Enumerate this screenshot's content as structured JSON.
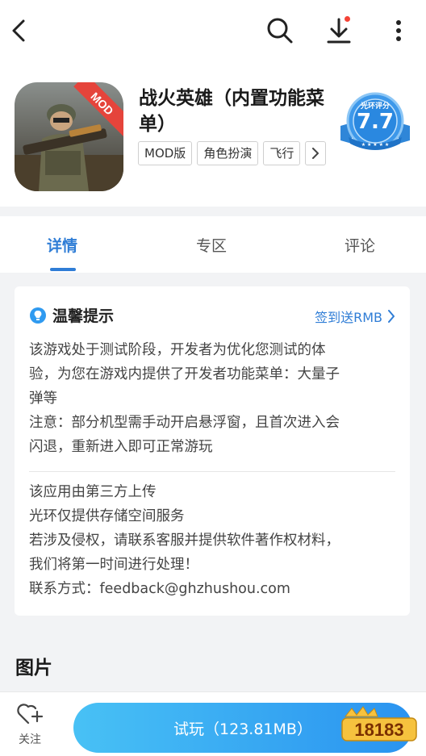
{
  "header": {
    "title": "战火英雄（内置功能菜单）",
    "icon_badge": "MOD",
    "tags": [
      "MOD版",
      "角色扮演",
      "飞行"
    ],
    "rating_label": "光环评分",
    "rating_score": "7.7"
  },
  "tabs": [
    {
      "label": "详情",
      "active": true
    },
    {
      "label": "专区",
      "active": false
    },
    {
      "label": "评论",
      "active": false
    }
  ],
  "notice": {
    "title": "温馨提示",
    "link": "签到送RMB",
    "lines1": [
      "该游戏处于测试阶段，开发者为优化您测试的体",
      "验，为您在游戏内提供了开发者功能菜单：大量子",
      "弹等",
      "注意：部分机型需手动开启悬浮窗，且首次进入会",
      "闪退，重新进入即可正常游玩"
    ],
    "lines2": [
      "该应用由第三方上传",
      "光环仅提供存储空间服务",
      "若涉及侵权，请联系客服并提供软件著作权材料，",
      "我们将第一时间进行处理！",
      "联系方式：feedback@ghzhushou.com"
    ]
  },
  "section_pictures": "图片",
  "bottom": {
    "follow_label": "关注",
    "play_button": "试玩（123.81MB）",
    "watermark": "18183"
  },
  "colors": {
    "accent": "#2f7dd6",
    "button_gradient_start": "#48c1f5",
    "button_gradient_end": "#2a93f0",
    "notification_dot": "#f44336"
  },
  "icons": {
    "back": "back-arrow-icon",
    "search": "search-icon",
    "download": "download-icon",
    "more": "more-vertical-icon",
    "notice": "lightbulb-icon",
    "link_arrow": "chevron-right-icon",
    "follow": "heart-add-icon"
  }
}
